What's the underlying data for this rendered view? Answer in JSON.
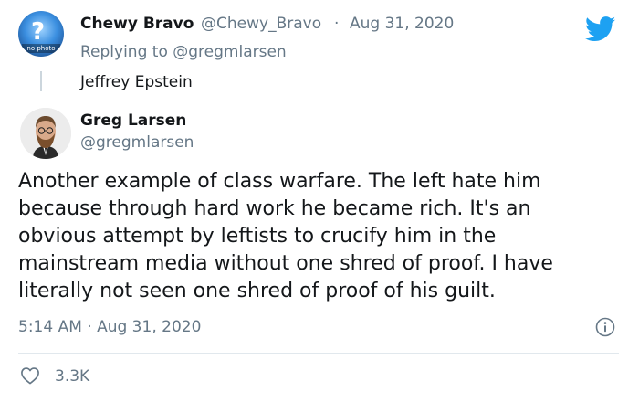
{
  "reply_tweet": {
    "avatar_caption": "no photo",
    "display_name": "Chewy Bravo",
    "handle": "@Chewy_Bravo",
    "separator": "·",
    "date": "Aug 31, 2020",
    "replying_to_label": "Replying to",
    "replying_to_handle": "@gregmlarsen",
    "text": "Jeffrey Epstein"
  },
  "main_tweet": {
    "display_name": "Greg Larsen",
    "handle": "@gregmlarsen",
    "text_lines": [
      "Another example of class warfare. The left hate him",
      "because through hard work he became rich. It's an",
      "obvious attempt by leftists to crucify him in the",
      "mainstream media without one shred of proof. I have",
      "literally not seen one shred of proof of his guilt."
    ],
    "timestamp": "5:14 AM · Aug 31, 2020",
    "likes": "3.3K"
  },
  "colors": {
    "twitter_blue": "#1DA1F2",
    "secondary_text": "#657786",
    "primary_text": "#14171A",
    "divider": "#E1E8ED"
  },
  "icons": {
    "brand": "twitter-bird-icon",
    "info": "info-icon",
    "like": "heart-icon"
  }
}
